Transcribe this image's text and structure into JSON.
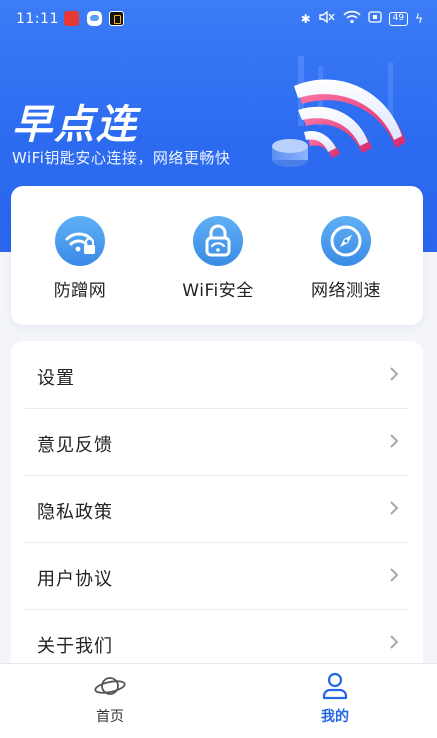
{
  "status_bar": {
    "time": "11:11",
    "battery": "49",
    "icons": [
      "bluetooth-icon",
      "mute-icon",
      "wifi-icon",
      "screen-icon",
      "battery-icon",
      "charging-icon"
    ]
  },
  "header": {
    "brand": "早点连",
    "subtitle": "WiFi钥匙安心连接，网络更畅快"
  },
  "quick_actions": [
    {
      "label": "防蹭网",
      "icon": "wifi-lock-icon"
    },
    {
      "label": "WiFi安全",
      "icon": "padlock-icon"
    },
    {
      "label": "网络测速",
      "icon": "compass-icon"
    }
  ],
  "menu": [
    {
      "label": "设置"
    },
    {
      "label": "意见反馈"
    },
    {
      "label": "隐私政策"
    },
    {
      "label": "用户协议"
    },
    {
      "label": "关于我们"
    }
  ],
  "tabbar": {
    "home_label": "首页",
    "mine_label": "我的",
    "active_color": "#2565e8"
  },
  "colors": {
    "brand_blue": "#2c6bf0",
    "icon_blue": "#3a8ae6",
    "wifi_art_pink": "#e8407a"
  }
}
